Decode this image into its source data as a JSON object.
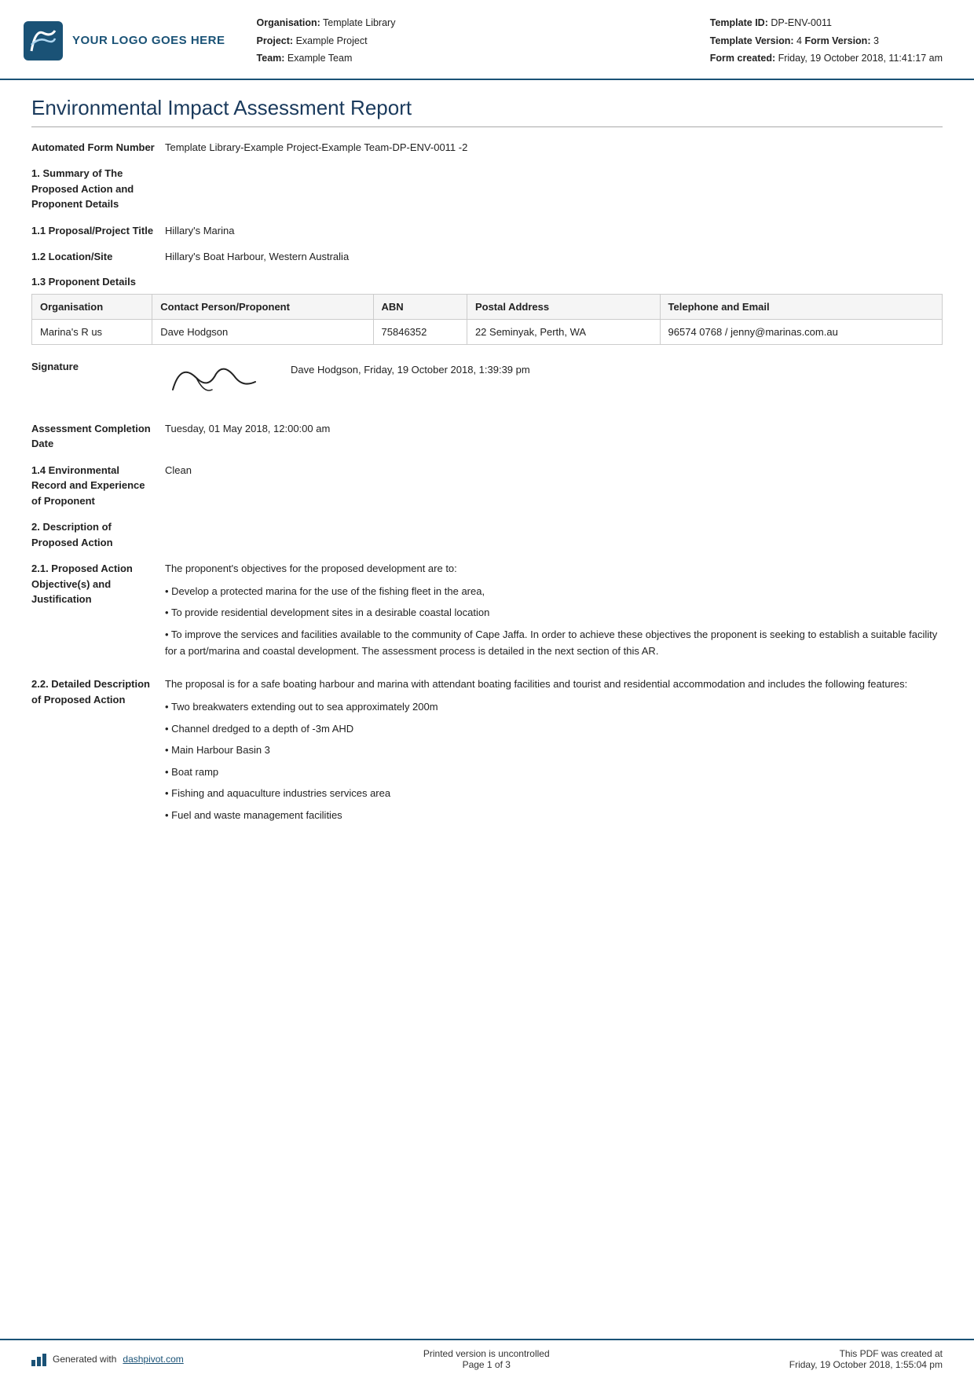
{
  "header": {
    "logo_text": "YOUR LOGO GOES HERE",
    "org_label": "Organisation:",
    "org_value": "Template Library",
    "project_label": "Project:",
    "project_value": "Example Project",
    "team_label": "Team:",
    "team_value": "Example Team",
    "template_id_label": "Template ID:",
    "template_id_value": "DP-ENV-0011",
    "template_version_label": "Template Version:",
    "template_version_value": "4",
    "form_version_label": "Form Version:",
    "form_version_value": "3",
    "form_created_label": "Form created:",
    "form_created_value": "Friday, 19 October 2018, 11:41:17 am"
  },
  "report": {
    "title": "Environmental Impact Assessment Report",
    "automated_form_number_label": "Automated Form Number",
    "automated_form_number_value": "Template Library-Example Project-Example Team-DP-ENV-0011  -2",
    "section1_label": "1. Summary of The Proposed Action and Proponent Details",
    "section1_1_label": "1.1 Proposal/Project Title",
    "section1_1_value": "Hillary's Marina",
    "section1_2_label": "1.2 Location/Site",
    "section1_2_value": "Hillary's Boat Harbour, Western Australia",
    "section1_3_label": "1.3 Proponent Details",
    "table": {
      "headers": [
        "Organisation",
        "Contact Person/Proponent",
        "ABN",
        "Postal Address",
        "Telephone and Email"
      ],
      "rows": [
        {
          "organisation": "Marina's R us",
          "contact": "Dave Hodgson",
          "abn": "75846352",
          "postal_address": "22 Seminyak, Perth, WA",
          "telephone_email": "96574 0768 / jenny@marinas.com.au"
        }
      ]
    },
    "signature_label": "Signature",
    "signature_text": "Dave Hodgson, Friday, 19 October 2018, 1:39:39 pm",
    "signature_cursive": "Cann",
    "assessment_completion_label": "Assessment Completion Date",
    "assessment_completion_value": "Tuesday, 01 May 2018, 12:00:00 am",
    "section1_4_label": "1.4 Environmental Record and Experience of Proponent",
    "section1_4_value": "Clean",
    "section2_label": "2. Description of Proposed Action",
    "section2_1_label": "2.1. Proposed Action Objective(s) and Justification",
    "section2_1_intro": "The proponent's objectives for the proposed development are to:",
    "section2_1_bullets": [
      "Develop a protected marina for the use of the fishing fleet in the area,",
      "To provide residential development sites in a desirable coastal location"
    ],
    "section2_1_para": "• To improve the services and facilities available to the community of Cape Jaffa. In order to achieve these objectives the proponent is seeking to establish a suitable facility for a port/marina and coastal development. The assessment process is detailed in the next section of this AR.",
    "section2_2_label": "2.2. Detailed Description of Proposed Action",
    "section2_2_intro": "The proposal is for a safe boating harbour and marina with attendant boating facilities and tourist and residential accommodation and includes the following features:",
    "section2_2_bullets": [
      "Two breakwaters extending out to sea approximately 200m",
      "Channel dredged to a depth of -3m AHD",
      "Main Harbour Basin 3",
      "Boat ramp",
      "Fishing and aquaculture industries services area",
      "Fuel and waste management facilities"
    ]
  },
  "footer": {
    "generated_text": "Generated with",
    "generated_link": "dashpivot.com",
    "center_line1": "Printed version is uncontrolled",
    "center_line2": "Page 1 of 3",
    "right_line1": "This PDF was created at",
    "right_line2": "Friday, 19 October 2018, 1:55:04 pm"
  }
}
